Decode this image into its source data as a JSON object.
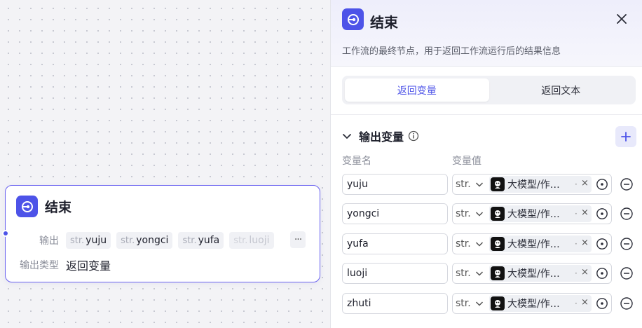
{
  "canvas_node": {
    "title": "结束",
    "output_label": "输出",
    "outputs": [
      {
        "type": "str.",
        "name": "yuju"
      },
      {
        "type": "str.",
        "name": "yongci"
      },
      {
        "type": "str.",
        "name": "yufa"
      },
      {
        "type": "str.",
        "name": "luoji"
      }
    ],
    "more_label": "···",
    "output_type_label": "输出类型",
    "output_type_value": "返回变量"
  },
  "panel": {
    "title": "结束",
    "description": "工作流的最终节点，用于返回工作流运行后的结果信息",
    "tabs": [
      {
        "label": "返回变量",
        "active": true
      },
      {
        "label": "返回文本",
        "active": false
      }
    ],
    "section_title": "输出变量",
    "col_name": "变量名",
    "col_value": "变量值",
    "variables": [
      {
        "name": "yuju",
        "type": "str.",
        "ref": "大模型/作…",
        "dot": "·",
        "clear": "×"
      },
      {
        "name": "yongci",
        "type": "str.",
        "ref": "大模型/作…",
        "dot": "·",
        "clear": "×"
      },
      {
        "name": "yufa",
        "type": "str.",
        "ref": "大模型/作…",
        "dot": "·",
        "clear": "×"
      },
      {
        "name": "luoji",
        "type": "str.",
        "ref": "大模型/作…",
        "dot": "·",
        "clear": "×"
      },
      {
        "name": "zhuti",
        "type": "str.",
        "ref": "大模型/作…",
        "dot": "·",
        "clear": "×"
      }
    ]
  },
  "colors": {
    "accent": "#4d53e8",
    "node_border": "#6a62f0"
  }
}
